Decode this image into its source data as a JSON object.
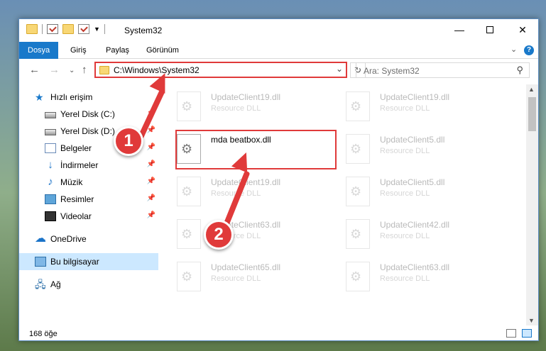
{
  "window": {
    "title": "System32"
  },
  "ribbon": {
    "tabs": [
      {
        "label": "Dosya",
        "active": true
      },
      {
        "label": "Giriş"
      },
      {
        "label": "Paylaş"
      },
      {
        "label": "Görünüm"
      }
    ]
  },
  "nav": {
    "address_path": "C:\\Windows\\System32",
    "search_placeholder": "Ara: System32"
  },
  "sidebar": {
    "items": [
      {
        "label": "Hızlı erişim",
        "icon": "star-icon"
      },
      {
        "label": "Yerel Disk (C:)",
        "icon": "drive-icon",
        "pinned": true
      },
      {
        "label": "Yerel Disk (D:)",
        "icon": "drive-icon",
        "pinned": true
      },
      {
        "label": "Belgeler",
        "icon": "document-icon",
        "pinned": true
      },
      {
        "label": "İndirmeler",
        "icon": "download-icon",
        "pinned": true
      },
      {
        "label": "Müzik",
        "icon": "music-icon",
        "pinned": true
      },
      {
        "label": "Resimler",
        "icon": "picture-icon",
        "pinned": true
      },
      {
        "label": "Videolar",
        "icon": "video-icon",
        "pinned": true
      },
      {
        "label": "OneDrive",
        "icon": "cloud-icon"
      },
      {
        "label": "Bu bilgisayar",
        "icon": "computer-icon",
        "selected": true
      },
      {
        "label": "Ağ",
        "icon": "network-icon"
      }
    ]
  },
  "files": [
    {
      "name": "UpdateClient19.dll",
      "type": "Resource DLL",
      "faded": true
    },
    {
      "name": "UpdateClient19.dll",
      "type": "Resource DLL",
      "faded": true
    },
    {
      "name": "mda beatbox.dll",
      "type": "",
      "faded": false
    },
    {
      "name": "UpdateClient5.dll",
      "type": "Resource DLL",
      "faded": true
    },
    {
      "name": "UpdateClient19.dll",
      "type": "Resource DLL",
      "faded": true
    },
    {
      "name": "UpdateClient5.dll",
      "type": "Resource DLL",
      "faded": true
    },
    {
      "name": "UpdateClient63.dll",
      "type": "Resource DLL",
      "faded": true
    },
    {
      "name": "UpdateClient42.dll",
      "type": "Resource DLL",
      "faded": true
    },
    {
      "name": "UpdateClient65.dll",
      "type": "Resource DLL",
      "faded": true
    },
    {
      "name": "UpdateClient63.dll",
      "type": "Resource DLL",
      "faded": true
    }
  ],
  "status": {
    "item_count": "168 öğe"
  },
  "callouts": [
    {
      "number": "1"
    },
    {
      "number": "2"
    }
  ],
  "colors": {
    "accent": "#1979ca",
    "callout": "#e03a3a",
    "selected": "#cce8ff"
  }
}
